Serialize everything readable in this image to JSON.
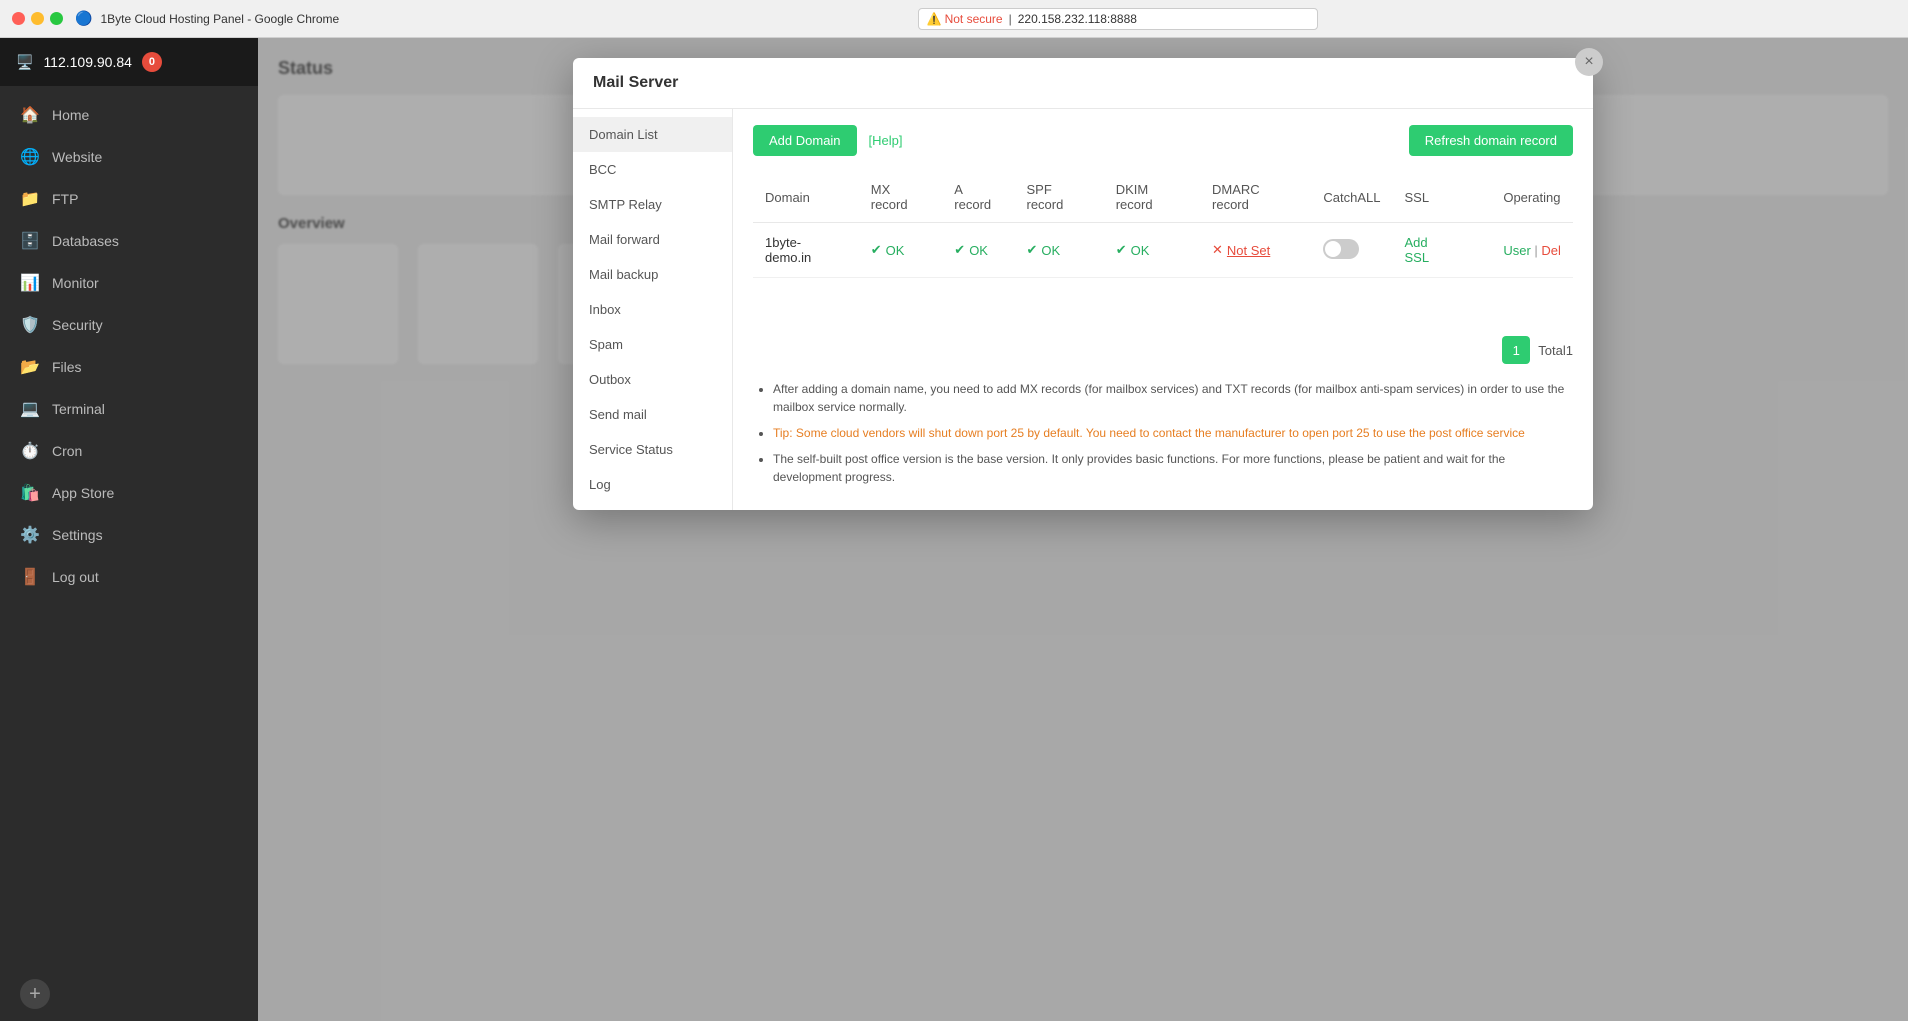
{
  "browser": {
    "title": "1Byte Cloud Hosting Panel - Google Chrome",
    "address": "220.158.232.118:8888",
    "not_secure_label": "Not secure"
  },
  "sidebar": {
    "server_ip": "112.109.90.84",
    "badge": "0",
    "nav_items": [
      {
        "id": "home",
        "label": "Home",
        "icon": "🏠"
      },
      {
        "id": "website",
        "label": "Website",
        "icon": "🌐"
      },
      {
        "id": "ftp",
        "label": "FTP",
        "icon": "📁"
      },
      {
        "id": "databases",
        "label": "Databases",
        "icon": "🗄️"
      },
      {
        "id": "monitor",
        "label": "Monitor",
        "icon": "📊"
      },
      {
        "id": "security",
        "label": "Security",
        "icon": "🛡️"
      },
      {
        "id": "files",
        "label": "Files",
        "icon": "📂"
      },
      {
        "id": "terminal",
        "label": "Terminal",
        "icon": "💻"
      },
      {
        "id": "cron",
        "label": "Cron",
        "icon": "⏱️"
      },
      {
        "id": "appstore",
        "label": "App Store",
        "icon": "🛍️"
      },
      {
        "id": "settings",
        "label": "Settings",
        "icon": "⚙️"
      },
      {
        "id": "logout",
        "label": "Log out",
        "icon": "🚪"
      }
    ]
  },
  "modal": {
    "title": "Mail Server",
    "close_label": "×",
    "nav_items": [
      {
        "id": "domain-list",
        "label": "Domain List",
        "active": true
      },
      {
        "id": "bcc",
        "label": "BCC"
      },
      {
        "id": "smtp-relay",
        "label": "SMTP Relay"
      },
      {
        "id": "mail-forward",
        "label": "Mail forward"
      },
      {
        "id": "mail-backup",
        "label": "Mail backup"
      },
      {
        "id": "inbox",
        "label": "Inbox"
      },
      {
        "id": "spam",
        "label": "Spam"
      },
      {
        "id": "outbox",
        "label": "Outbox"
      },
      {
        "id": "send-mail",
        "label": "Send mail"
      },
      {
        "id": "service-status",
        "label": "Service Status"
      },
      {
        "id": "log",
        "label": "Log"
      }
    ],
    "toolbar": {
      "add_domain_label": "Add Domain",
      "help_label": "[Help]",
      "refresh_label": "Refresh domain record"
    },
    "table": {
      "columns": [
        "Domain",
        "MX record",
        "A record",
        "SPF record",
        "DKIM record",
        "DMARC record",
        "CatchALL",
        "SSL",
        "",
        "Operating"
      ],
      "rows": [
        {
          "domain": "1byte-demo.in",
          "mx_record": "OK",
          "a_record": "OK",
          "spf_record": "OK",
          "dkim_record": "OK",
          "dmarc_record": "Not Set",
          "catchall": false,
          "ssl": "Add SSL",
          "operating_user": "User",
          "operating_del": "Del"
        }
      ]
    },
    "pagination": {
      "current_page": "1",
      "total_label": "Total1"
    },
    "notes": [
      "After adding a domain name, you need to add MX records (for mailbox services) and TXT records (for mailbox anti-spam services) in order to use the mailbox service normally.",
      "Tip: Some cloud vendors will shut down port 25 by default. You need to contact the manufacturer to open port 25 to use the post office service",
      "The self-built post office version is the base version. It only provides basic functions. For more functions, please be patient and wait for the development progress."
    ]
  }
}
